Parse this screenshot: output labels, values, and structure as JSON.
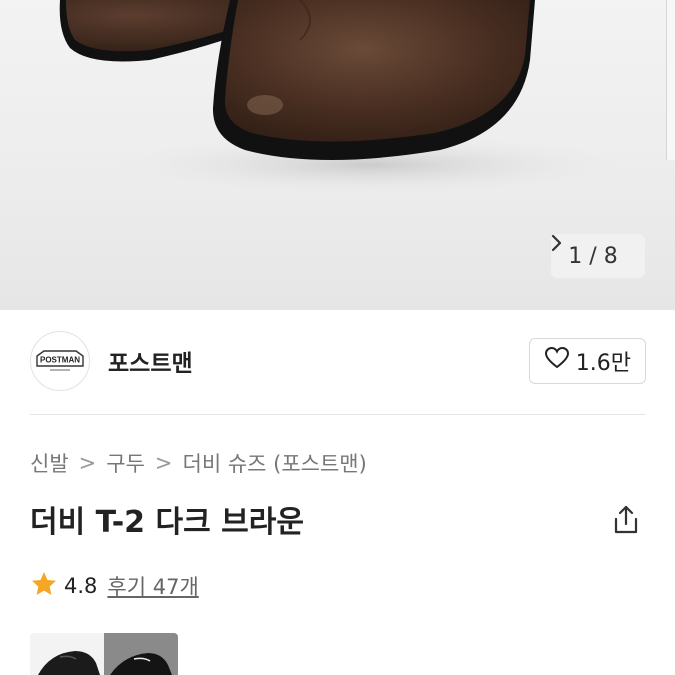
{
  "gallery": {
    "counter_current": "1",
    "counter_sep": "/",
    "counter_total": "8",
    "next_icon": "chevron-right-icon"
  },
  "shop": {
    "logo_text": "POSTMAN",
    "name": "포스트맨",
    "like_icon": "heart-outline-icon",
    "like_count": "1.6만"
  },
  "breadcrumb": {
    "items": [
      "신발",
      "구두",
      "더비 슈즈 (포스트맨)"
    ],
    "separator": ">"
  },
  "product": {
    "title": "더비 T-2 다크 브라운",
    "share_icon": "share-icon"
  },
  "rating": {
    "star_icon": "star-icon",
    "star_color": "#f5a623",
    "score": "4.8",
    "reviews_label": "후기 47개"
  }
}
